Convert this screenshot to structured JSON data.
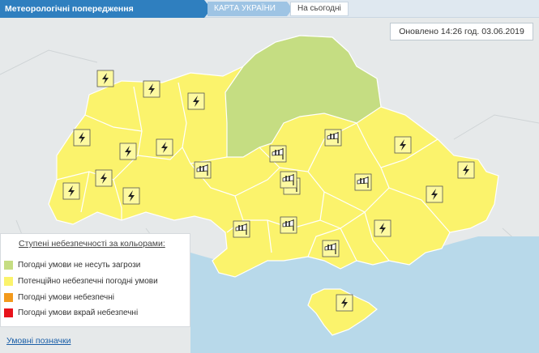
{
  "header": {
    "title": "Метеорологічні попередження",
    "map_tab": "КАРТА УКРАЇНИ",
    "today_tab": "На сьогодні"
  },
  "updated": "Оновлено 14:26 год. 03.06.2019",
  "legend": {
    "title": "Ступені небезпечності за кольорами:",
    "items": [
      {
        "label": "Погодні умови не несуть загрози",
        "color": "#c5dd82"
      },
      {
        "label": "Потенційно небезпечні погодні умови",
        "color": "#fbf36c"
      },
      {
        "label": "Погодні умови небезпечні",
        "color": "#f39a1c"
      },
      {
        "label": "Погодні умови вкрай небезпечні",
        "color": "#e8131b"
      }
    ],
    "link": "Умовні позначки"
  },
  "colors": {
    "yellow": "#fbf36c",
    "green": "#c5dd82",
    "sea": "#b8d9ea",
    "land_bg": "#e6e9ea",
    "border": "#ffffff"
  },
  "warnings": [
    {
      "region": "volyn",
      "icon": "thunderstorm-icon"
    },
    {
      "region": "rivne",
      "icon": "thunderstorm-icon"
    },
    {
      "region": "zhytomyr",
      "icon": "thunderstorm-icon"
    },
    {
      "region": "lviv",
      "icon": "thunderstorm-icon"
    },
    {
      "region": "ternopil",
      "icon": "thunderstorm-icon"
    },
    {
      "region": "khmelnytskyi",
      "icon": "thunderstorm-icon"
    },
    {
      "region": "zakarpattia",
      "icon": "thunderstorm-icon"
    },
    {
      "region": "ivano-frankivsk",
      "icon": "thunderstorm-icon"
    },
    {
      "region": "chernivtsi",
      "icon": "thunderstorm-icon"
    },
    {
      "region": "vinnytsia",
      "icon": "wind-icon"
    },
    {
      "region": "poltava",
      "icon": "wind-icon"
    },
    {
      "region": "cherkasy",
      "icon": "wind-icon"
    },
    {
      "region": "kharkiv",
      "icon": "thunderstorm-icon"
    },
    {
      "region": "luhansk",
      "icon": "thunderstorm-icon"
    },
    {
      "region": "donetsk",
      "icon": "thunderstorm-icon"
    },
    {
      "region": "dnipro",
      "icon": "wind-icon"
    },
    {
      "region": "odesa-north",
      "icon": "wind-icon"
    },
    {
      "region": "kirovohrad",
      "icon": "wind-icon"
    },
    {
      "region": "mykolaiv",
      "icon": "wind-icon"
    },
    {
      "region": "zaporizhzhia",
      "icon": "thunderstorm-icon"
    },
    {
      "region": "kherson",
      "icon": "wind-icon"
    },
    {
      "region": "crimea",
      "icon": "thunderstorm-icon"
    },
    {
      "region": "sumy",
      "icon": "wind-icon"
    }
  ]
}
